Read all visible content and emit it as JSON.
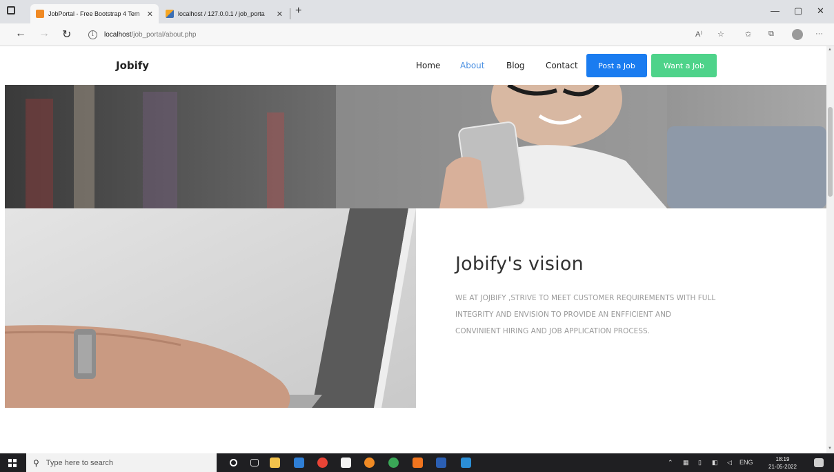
{
  "browser": {
    "tabs": [
      {
        "title": "JobPortal - Free Bootstrap 4 Tem",
        "active": true
      },
      {
        "title": "localhost / 127.0.0.1 / job_porta",
        "active": false
      }
    ],
    "url_host": "localhost",
    "url_path": "/job_portal/about.php",
    "icons": {
      "back": "←",
      "forward": "→",
      "refresh": "↻",
      "new_tab": "+",
      "minimize": "—",
      "maximize": "▢",
      "close": "✕",
      "tab_close": "✕",
      "read_aloud": "A⁾",
      "favorite": "☆",
      "favorites": "✩",
      "collections": "⧉",
      "more": "···"
    }
  },
  "site": {
    "brand": "Jobify",
    "nav": [
      {
        "label": "Home",
        "active": false
      },
      {
        "label": "About",
        "active": true
      },
      {
        "label": "Blog",
        "active": false
      },
      {
        "label": "Contact",
        "active": false
      }
    ],
    "post_job_label": "Post a Job",
    "want_job_label": "Want a Job",
    "accent_blue": "#1a7cf0",
    "accent_green": "#4ed38a",
    "active_link_color": "#4a90e2"
  },
  "about": {
    "heading": "Jobify's vision",
    "body": "WE AT JOJBIFY ,STRIVE TO MEET CUSTOMER REQUIREMENTS WITH FULL INTEGRITY AND ENVISION TO PROVIDE AN ENFFICIENT AND CONVINIENT HIRING AND JOB APPLICATION PROCESS."
  },
  "taskbar": {
    "search_placeholder": "Type here to search",
    "language": "ENG",
    "time": "18:19",
    "date": "21-05-2022",
    "icons": [
      "cortana-icon",
      "task-view-icon",
      "file-explorer-icon",
      "mail-icon",
      "chrome-icon",
      "notepad-icon",
      "firefox-icon",
      "chrome-alt-icon",
      "xampp-icon",
      "word-icon",
      "photos-icon"
    ]
  }
}
